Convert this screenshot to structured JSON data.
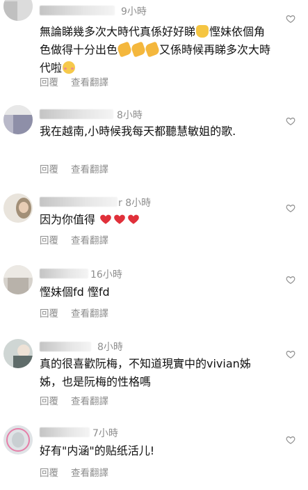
{
  "comments": [
    {
      "name_suffix": "",
      "time": "9小時",
      "text_parts": [
        "無論睇幾多次大時代真係好好睇",
        "慳妹依個角色做得十分出色",
        "又係時候再睇多次大時代啦"
      ],
      "emoji": [
        "thumbs-up",
        "clapping-hands",
        "clapping-hands",
        "clapping-hands",
        "blushing-face"
      ],
      "reply": "回覆",
      "translate": "查看翻譯"
    },
    {
      "name_suffix": "",
      "time": "8小時",
      "text": "我在越南,小時候我每天都聽慧敏姐的歌.",
      "reply": "回覆",
      "translate": "查看翻譯"
    },
    {
      "name_suffix": "r",
      "time": "8小時",
      "text": "因为你值得",
      "emoji": [
        "red-heart",
        "red-heart",
        "red-heart"
      ],
      "reply": "回覆",
      "translate": "查看翻譯"
    },
    {
      "name_suffix": "",
      "time": "16小時",
      "text": "慳妹個fd 慳fd",
      "reply": "回覆",
      "translate": "查看翻譯"
    },
    {
      "name_suffix": "",
      "time": "8小時",
      "text": "真的很喜歡阮梅，不知道現實中的vivian姊姊，也是阮梅的性格嗎",
      "reply": "回覆",
      "translate": "查看翻譯"
    },
    {
      "name_suffix": "",
      "time": "7小時",
      "text": "好有\"内涵\"的贴纸活儿!",
      "reply": "回覆",
      "translate": "查看翻譯"
    }
  ],
  "colors": {
    "text": "#111111",
    "muted": "#8e8e8e",
    "heart_outline": "#8e8e8e",
    "heart_emoji": "#e0303a"
  },
  "icons": {
    "like": "heart-outline-icon"
  }
}
